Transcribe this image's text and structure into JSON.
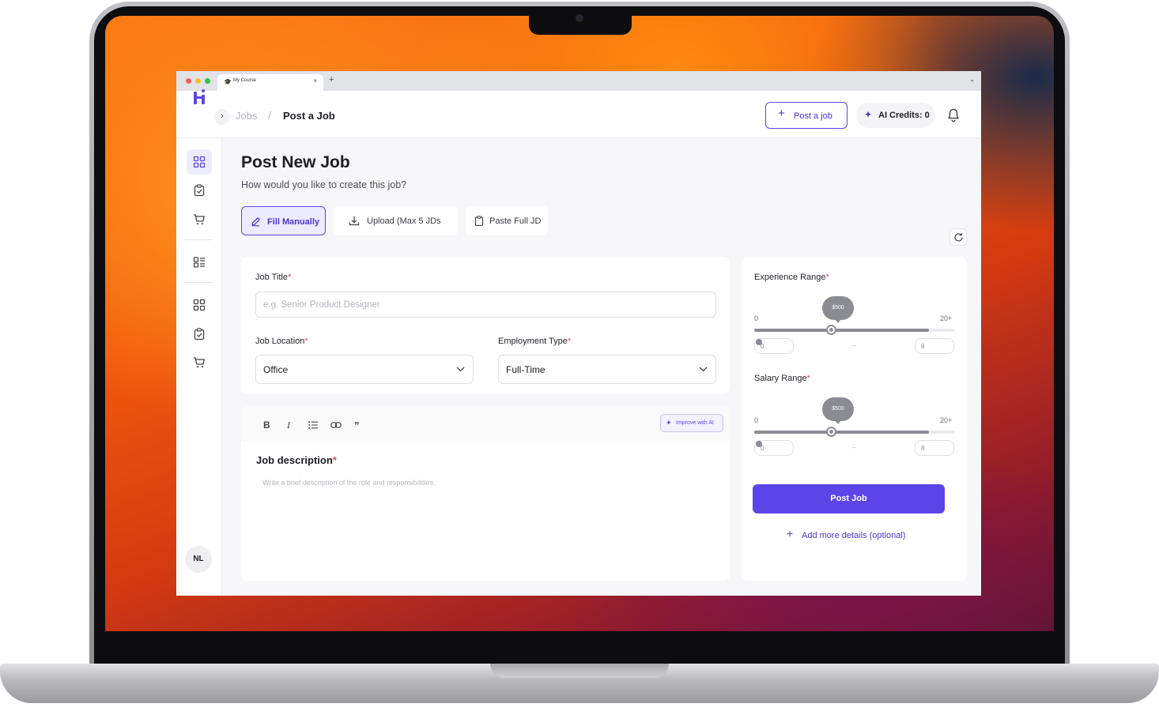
{
  "browser": {
    "tab_title": "My Course",
    "tab_close": "×",
    "new_tab": "+",
    "tab_menu": "⌄",
    "traffic_light_colors": [
      "#ff5f57",
      "#febc2e",
      "#28c840"
    ]
  },
  "header": {
    "expand_icon": "›",
    "breadcrumb": [
      "Jobs",
      "Post a Job"
    ],
    "breadcrumb_separator": "/",
    "post_job_button": "Post a job",
    "post_job_plus": "+",
    "ai_credits": "AI Credits: 0",
    "ai_icon": "sparkle-icon",
    "notification_icon": "bell-icon"
  },
  "sidebar": {
    "icons": [
      "dashboard-icon",
      "clipboard-check-icon",
      "cart-icon",
      "list-icon",
      "dashboard-icon",
      "clipboard-check-icon",
      "cart-icon"
    ],
    "active_index": 0,
    "avatar_initials": "NL"
  },
  "page": {
    "title": "Post New Job",
    "subtitle": "How would you like to create this job?",
    "modes": [
      {
        "label": "Fill Manually",
        "icon": "pencil-icon",
        "active": true
      },
      {
        "label": "Upload (Max 5 JDs",
        "icon": "download-icon",
        "active": false
      },
      {
        "label": "Paste Full JD",
        "icon": "clipboard-icon",
        "active": false
      }
    ]
  },
  "form": {
    "job_title_label": "Job Title",
    "job_title_placeholder": "e.g. Senior Product Designer",
    "job_location_label": "Job Location",
    "job_location_value": "Office",
    "employment_type_label": "Employment Type",
    "employment_type_value": "Full-Time",
    "required_mark": "*",
    "editor_tools": [
      "B",
      "I",
      "list",
      "link",
      "quote"
    ],
    "improve_button": "Improve with AI",
    "description_label": "Job description",
    "description_placeholder": "Write a brief description of the role and responsibilities."
  },
  "ranges": {
    "experience": {
      "label": "Experience Range",
      "min_label": "0",
      "max_label": "20+",
      "bubble": "$500",
      "min_value": "0",
      "max_value": "8",
      "handle_fraction": 0.38,
      "fill_fraction": 0.87
    },
    "salary": {
      "label": "Salary Range",
      "min_label": "0",
      "max_label": "20+",
      "bubble": "$500",
      "min_value": "0",
      "max_value": "8",
      "handle_fraction": 0.38,
      "fill_fraction": 0.87
    },
    "separator": "–"
  },
  "actions": {
    "post_job": "Post Job",
    "add_more": "Add more details (optional)",
    "add_more_plus": "+"
  },
  "colors": {
    "accent": "#5b45e8",
    "required": "#e5484d",
    "slider": "#8b8b93"
  }
}
